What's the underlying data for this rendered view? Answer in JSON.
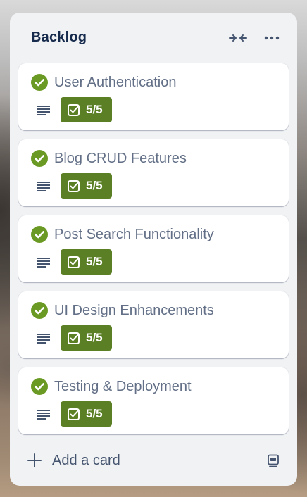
{
  "list": {
    "title": "Backlog",
    "header_icons": [
      "collapse-icon",
      "more-icon"
    ],
    "cards": [
      {
        "title": "User Authentication",
        "checklist": "5/5",
        "complete": true,
        "has_description": true
      },
      {
        "title": "Blog CRUD Features",
        "checklist": "5/5",
        "complete": true,
        "has_description": true
      },
      {
        "title": "Post Search Functionality",
        "checklist": "5/5",
        "complete": true,
        "has_description": true
      },
      {
        "title": "UI Design Enhancements",
        "checklist": "5/5",
        "complete": true,
        "has_description": true
      },
      {
        "title": "Testing & Deployment",
        "checklist": "5/5",
        "complete": true,
        "has_description": true
      }
    ],
    "footer": {
      "add_card_label": "Add a card",
      "template_icon": "card-template-icon"
    }
  },
  "colors": {
    "list_bg": "#f1f2f4",
    "complete_green": "#6a9a23",
    "badge_green": "#5b7f24",
    "title_text": "#172b4d",
    "card_text": "#626f86"
  }
}
